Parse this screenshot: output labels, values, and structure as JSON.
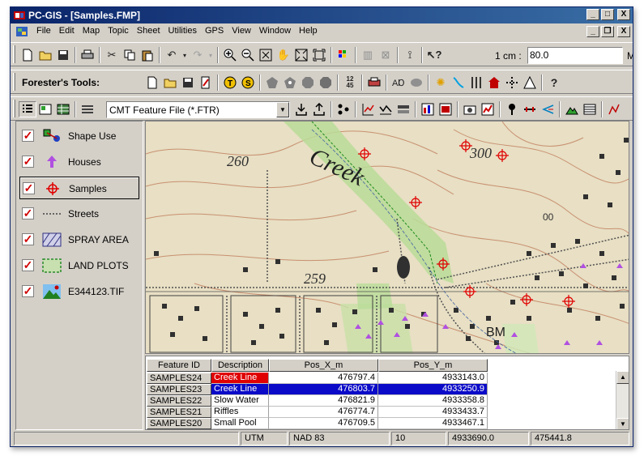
{
  "window": {
    "title": "PC-GIS - [Samples.FMP]",
    "controls": {
      "minimize": "_",
      "maximize": "□",
      "close": "X"
    }
  },
  "menubar": {
    "items": [
      "File",
      "Edit",
      "Map",
      "Topic",
      "Sheet",
      "Utilities",
      "GPS",
      "View",
      "Window",
      "Help"
    ],
    "doc_controls": {
      "minimize": "_",
      "restore": "❐",
      "close": "X"
    }
  },
  "toolbar1": {
    "scale_label": "1 cm :",
    "scale_value": "80.0",
    "scale_unit": "Me"
  },
  "toolbar2": {
    "label": "Forester's Tools:"
  },
  "toolbar3": {
    "feature_file_selected": "CMT Feature File (*.FTR)"
  },
  "layers": [
    {
      "name": "Shape Use",
      "checked": "✓",
      "icon": "shape-use-icon"
    },
    {
      "name": "Houses",
      "checked": "✓",
      "icon": "arrow-up-icon"
    },
    {
      "name": "Samples",
      "checked": "✓",
      "icon": "crosshair-icon",
      "selected": true
    },
    {
      "name": "Streets",
      "checked": "✓",
      "icon": "dotted-line-icon"
    },
    {
      "name": "SPRAY AREA",
      "checked": "✓",
      "icon": "hatch-icon"
    },
    {
      "name": "LAND PLOTS",
      "checked": "✓",
      "icon": "dashed-rect-icon"
    },
    {
      "name": "E344123.TIF",
      "checked": "✓",
      "icon": "image-icon"
    }
  ],
  "map": {
    "labels": {
      "creek": "Creek",
      "elev_260": "260",
      "elev_300": "300",
      "elev_259": "259",
      "label_00": "00",
      "label_bm": "BM"
    }
  },
  "grid": {
    "columns": [
      "Feature ID",
      "Description",
      "Pos_X_m",
      "Pos_Y_m"
    ],
    "rows": [
      {
        "id": "SAMPLES24",
        "desc": "Creek Line",
        "x": "476797.4",
        "y": "4933143.0"
      },
      {
        "id": "SAMPLES23",
        "desc": "Creek Line",
        "x": "476803.7",
        "y": "4933250.9"
      },
      {
        "id": "SAMPLES22",
        "desc": "Slow Water",
        "x": "476821.9",
        "y": "4933358.8"
      },
      {
        "id": "SAMPLES21",
        "desc": "Riffles",
        "x": "476774.7",
        "y": "4933433.7"
      },
      {
        "id": "SAMPLES20",
        "desc": "Small Pool",
        "x": "476709.5",
        "y": "4933467.1"
      }
    ]
  },
  "statusbar": {
    "projection": "UTM",
    "datum": "NAD 83",
    "zone": "10",
    "northing": "4933690.0",
    "easting": "475441.8"
  },
  "colors": {
    "title_start": "#0a246a",
    "title_end": "#3a6ea5",
    "highlight_red": "#e00000",
    "highlight_blue": "#0a0ac8",
    "chrome": "#d4d0c8"
  }
}
